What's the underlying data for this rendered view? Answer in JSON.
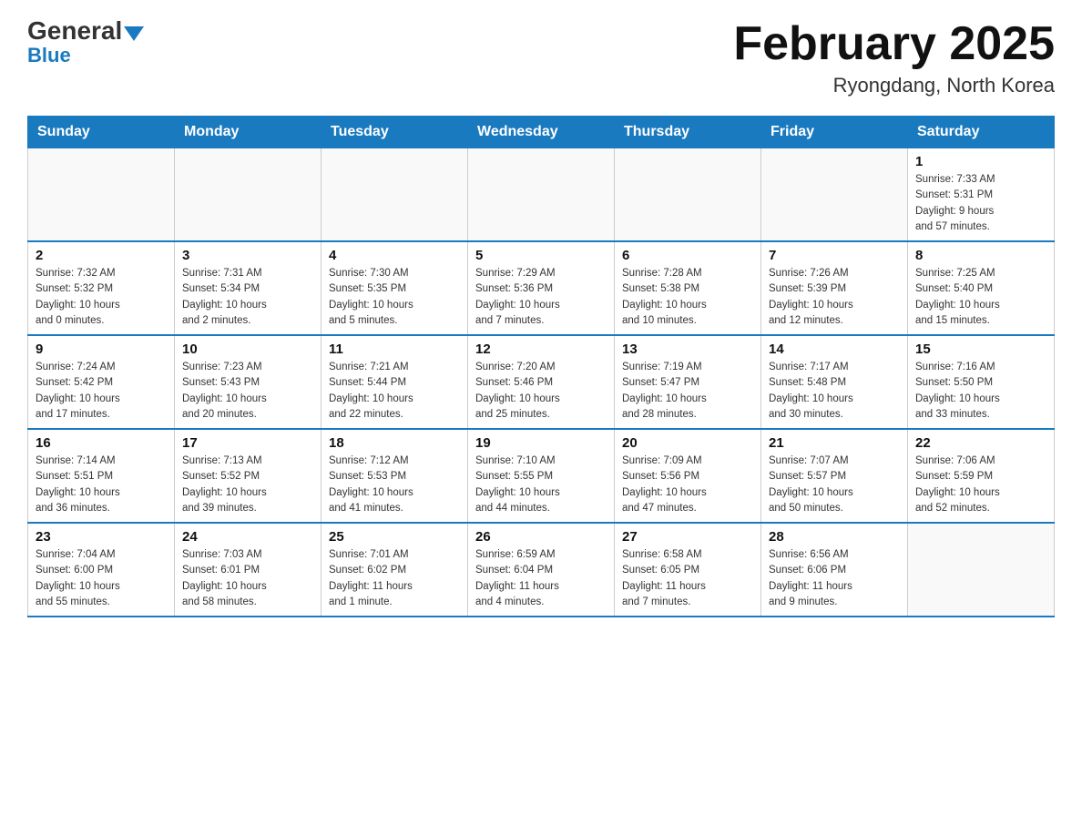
{
  "header": {
    "logo_general": "General",
    "logo_blue": "Blue",
    "month_title": "February 2025",
    "location": "Ryongdang, North Korea"
  },
  "weekdays": [
    "Sunday",
    "Monday",
    "Tuesday",
    "Wednesday",
    "Thursday",
    "Friday",
    "Saturday"
  ],
  "weeks": [
    [
      {
        "day": "",
        "info": ""
      },
      {
        "day": "",
        "info": ""
      },
      {
        "day": "",
        "info": ""
      },
      {
        "day": "",
        "info": ""
      },
      {
        "day": "",
        "info": ""
      },
      {
        "day": "",
        "info": ""
      },
      {
        "day": "1",
        "info": "Sunrise: 7:33 AM\nSunset: 5:31 PM\nDaylight: 9 hours\nand 57 minutes."
      }
    ],
    [
      {
        "day": "2",
        "info": "Sunrise: 7:32 AM\nSunset: 5:32 PM\nDaylight: 10 hours\nand 0 minutes."
      },
      {
        "day": "3",
        "info": "Sunrise: 7:31 AM\nSunset: 5:34 PM\nDaylight: 10 hours\nand 2 minutes."
      },
      {
        "day": "4",
        "info": "Sunrise: 7:30 AM\nSunset: 5:35 PM\nDaylight: 10 hours\nand 5 minutes."
      },
      {
        "day": "5",
        "info": "Sunrise: 7:29 AM\nSunset: 5:36 PM\nDaylight: 10 hours\nand 7 minutes."
      },
      {
        "day": "6",
        "info": "Sunrise: 7:28 AM\nSunset: 5:38 PM\nDaylight: 10 hours\nand 10 minutes."
      },
      {
        "day": "7",
        "info": "Sunrise: 7:26 AM\nSunset: 5:39 PM\nDaylight: 10 hours\nand 12 minutes."
      },
      {
        "day": "8",
        "info": "Sunrise: 7:25 AM\nSunset: 5:40 PM\nDaylight: 10 hours\nand 15 minutes."
      }
    ],
    [
      {
        "day": "9",
        "info": "Sunrise: 7:24 AM\nSunset: 5:42 PM\nDaylight: 10 hours\nand 17 minutes."
      },
      {
        "day": "10",
        "info": "Sunrise: 7:23 AM\nSunset: 5:43 PM\nDaylight: 10 hours\nand 20 minutes."
      },
      {
        "day": "11",
        "info": "Sunrise: 7:21 AM\nSunset: 5:44 PM\nDaylight: 10 hours\nand 22 minutes."
      },
      {
        "day": "12",
        "info": "Sunrise: 7:20 AM\nSunset: 5:46 PM\nDaylight: 10 hours\nand 25 minutes."
      },
      {
        "day": "13",
        "info": "Sunrise: 7:19 AM\nSunset: 5:47 PM\nDaylight: 10 hours\nand 28 minutes."
      },
      {
        "day": "14",
        "info": "Sunrise: 7:17 AM\nSunset: 5:48 PM\nDaylight: 10 hours\nand 30 minutes."
      },
      {
        "day": "15",
        "info": "Sunrise: 7:16 AM\nSunset: 5:50 PM\nDaylight: 10 hours\nand 33 minutes."
      }
    ],
    [
      {
        "day": "16",
        "info": "Sunrise: 7:14 AM\nSunset: 5:51 PM\nDaylight: 10 hours\nand 36 minutes."
      },
      {
        "day": "17",
        "info": "Sunrise: 7:13 AM\nSunset: 5:52 PM\nDaylight: 10 hours\nand 39 minutes."
      },
      {
        "day": "18",
        "info": "Sunrise: 7:12 AM\nSunset: 5:53 PM\nDaylight: 10 hours\nand 41 minutes."
      },
      {
        "day": "19",
        "info": "Sunrise: 7:10 AM\nSunset: 5:55 PM\nDaylight: 10 hours\nand 44 minutes."
      },
      {
        "day": "20",
        "info": "Sunrise: 7:09 AM\nSunset: 5:56 PM\nDaylight: 10 hours\nand 47 minutes."
      },
      {
        "day": "21",
        "info": "Sunrise: 7:07 AM\nSunset: 5:57 PM\nDaylight: 10 hours\nand 50 minutes."
      },
      {
        "day": "22",
        "info": "Sunrise: 7:06 AM\nSunset: 5:59 PM\nDaylight: 10 hours\nand 52 minutes."
      }
    ],
    [
      {
        "day": "23",
        "info": "Sunrise: 7:04 AM\nSunset: 6:00 PM\nDaylight: 10 hours\nand 55 minutes."
      },
      {
        "day": "24",
        "info": "Sunrise: 7:03 AM\nSunset: 6:01 PM\nDaylight: 10 hours\nand 58 minutes."
      },
      {
        "day": "25",
        "info": "Sunrise: 7:01 AM\nSunset: 6:02 PM\nDaylight: 11 hours\nand 1 minute."
      },
      {
        "day": "26",
        "info": "Sunrise: 6:59 AM\nSunset: 6:04 PM\nDaylight: 11 hours\nand 4 minutes."
      },
      {
        "day": "27",
        "info": "Sunrise: 6:58 AM\nSunset: 6:05 PM\nDaylight: 11 hours\nand 7 minutes."
      },
      {
        "day": "28",
        "info": "Sunrise: 6:56 AM\nSunset: 6:06 PM\nDaylight: 11 hours\nand 9 minutes."
      },
      {
        "day": "",
        "info": ""
      }
    ]
  ]
}
